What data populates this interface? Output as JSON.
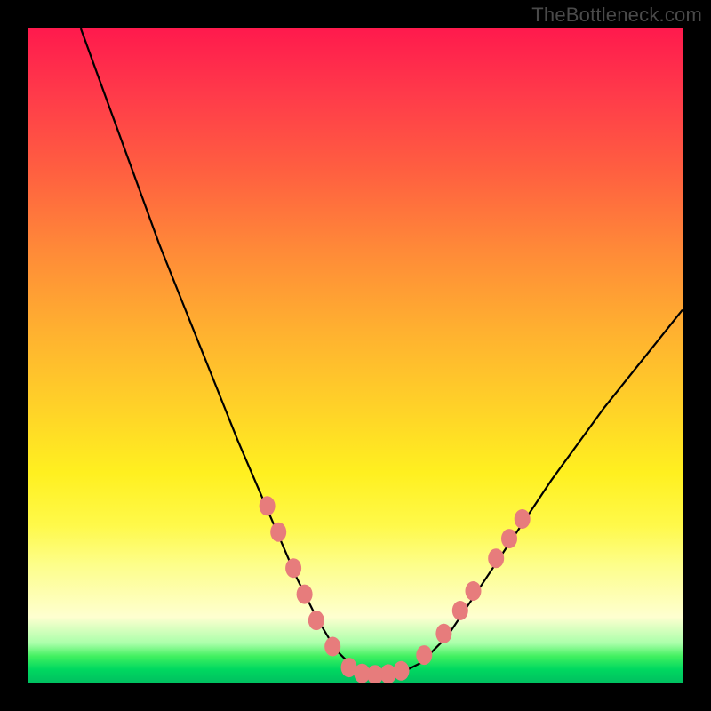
{
  "watermark": "TheBottleneck.com",
  "chart_data": {
    "type": "line",
    "title": "",
    "xlabel": "",
    "ylabel": "",
    "xlim": [
      0,
      100
    ],
    "ylim": [
      0,
      100
    ],
    "grid": false,
    "series": [
      {
        "name": "bottleneck-curve",
        "x": [
          8,
          12,
          16,
          20,
          24,
          28,
          32,
          35,
          38,
          41,
          44,
          47,
          50,
          53,
          56,
          60,
          64,
          68,
          74,
          80,
          88,
          96,
          100
        ],
        "y": [
          100,
          89,
          78,
          67,
          57,
          47,
          37,
          30,
          23,
          16,
          10,
          5,
          2,
          1,
          1,
          3,
          7,
          13,
          22,
          31,
          42,
          52,
          57
        ]
      }
    ],
    "markers": [
      {
        "name": "left-dot-1",
        "x": 36.5,
        "y": 27
      },
      {
        "name": "left-dot-2",
        "x": 38.2,
        "y": 23
      },
      {
        "name": "left-dot-3",
        "x": 40.5,
        "y": 17.5
      },
      {
        "name": "left-dot-4",
        "x": 42.2,
        "y": 13.5
      },
      {
        "name": "left-dot-5",
        "x": 44.0,
        "y": 9.5
      },
      {
        "name": "left-dot-6",
        "x": 46.5,
        "y": 5.5
      },
      {
        "name": "flat-dot-1",
        "x": 49.0,
        "y": 2.3
      },
      {
        "name": "flat-dot-2",
        "x": 51.0,
        "y": 1.4
      },
      {
        "name": "flat-dot-3",
        "x": 53.0,
        "y": 1.2
      },
      {
        "name": "flat-dot-4",
        "x": 55.0,
        "y": 1.3
      },
      {
        "name": "flat-dot-5",
        "x": 57.0,
        "y": 1.8
      },
      {
        "name": "right-dot-1",
        "x": 60.5,
        "y": 4.2
      },
      {
        "name": "right-dot-2",
        "x": 63.5,
        "y": 7.5
      },
      {
        "name": "right-dot-3",
        "x": 66.0,
        "y": 11
      },
      {
        "name": "right-dot-4",
        "x": 68.0,
        "y": 14
      },
      {
        "name": "right-dot-5",
        "x": 71.5,
        "y": 19
      },
      {
        "name": "right-dot-6",
        "x": 73.5,
        "y": 22
      },
      {
        "name": "right-dot-7",
        "x": 75.5,
        "y": 25
      }
    ],
    "marker_color": "#e77c7c",
    "curve_color": "#000000"
  }
}
